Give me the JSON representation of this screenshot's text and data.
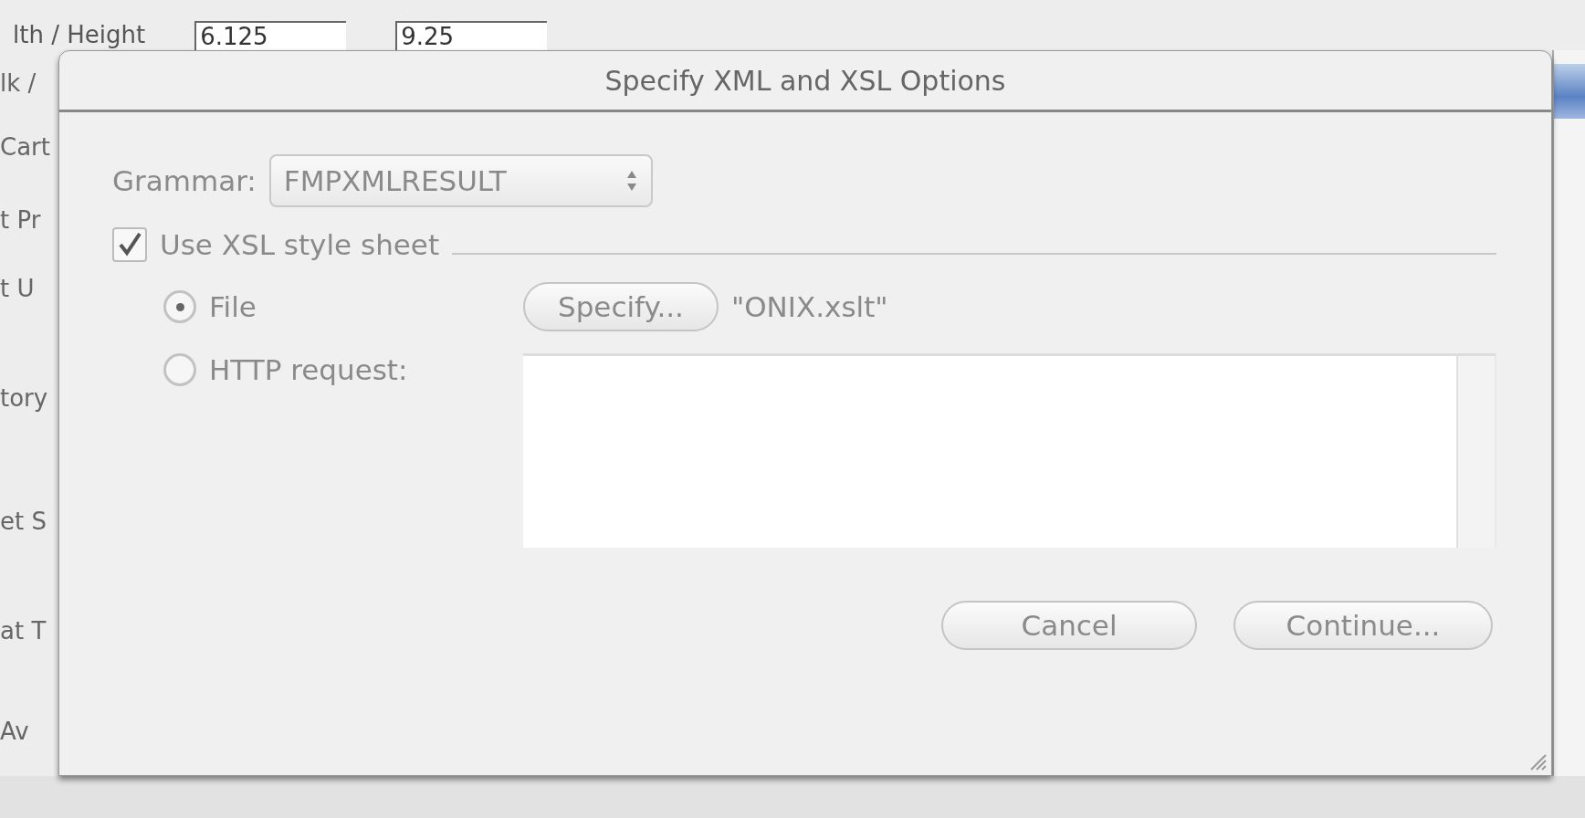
{
  "background": {
    "top_label": "lth / Height",
    "top_fields": [
      "6.125",
      "9.25"
    ],
    "left_labels": [
      "lk /",
      "Cart",
      "t Pr",
      "t U",
      "tory",
      "et S",
      "at T",
      "Av"
    ]
  },
  "dialog": {
    "title": "Specify XML and XSL Options",
    "grammar": {
      "label": "Grammar:",
      "value": "FMPXMLRESULT"
    },
    "xsl": {
      "label": "Use XSL style sheet",
      "checked": true
    },
    "sources": [
      {
        "label": "File",
        "selected": true,
        "button": "Specify...",
        "file": "\"ONIX.xslt\""
      },
      {
        "label": "HTTP request:",
        "selected": false
      }
    ],
    "buttons": [
      "Cancel",
      "Continue..."
    ]
  }
}
